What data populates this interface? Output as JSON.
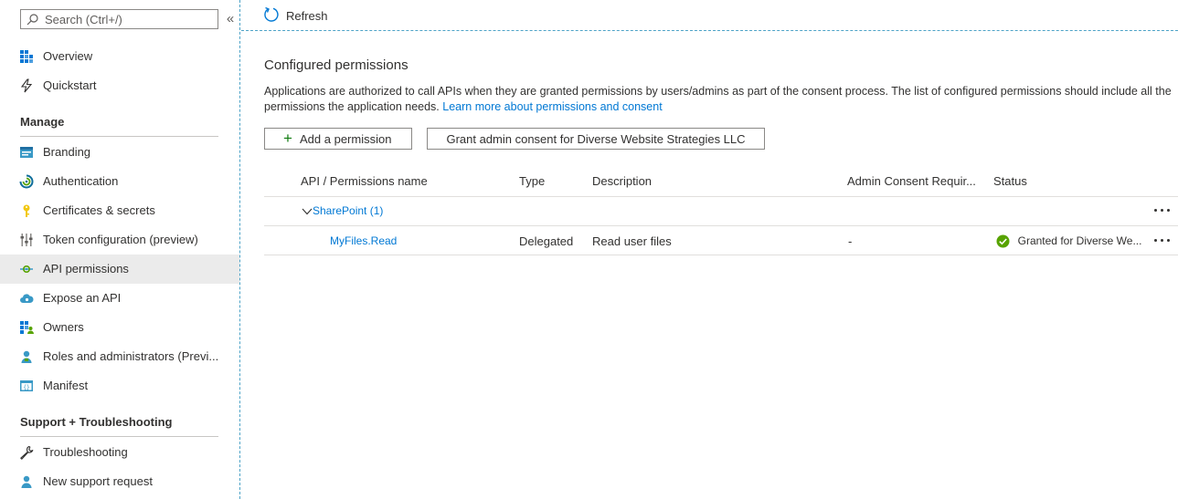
{
  "search": {
    "placeholder": "Search (Ctrl+/)"
  },
  "sidebar": {
    "collapse_glyph": "«",
    "top_items": [
      {
        "label": "Overview",
        "icon": "overview-grid-icon"
      },
      {
        "label": "Quickstart",
        "icon": "lightning-icon"
      }
    ],
    "manage_title": "Manage",
    "manage_items": [
      {
        "label": "Branding",
        "icon": "branding-icon"
      },
      {
        "label": "Authentication",
        "icon": "authentication-icon"
      },
      {
        "label": "Certificates & secrets",
        "icon": "key-icon"
      },
      {
        "label": "Token configuration (preview)",
        "icon": "sliders-icon"
      },
      {
        "label": "API permissions",
        "icon": "api-permissions-icon",
        "active": true
      },
      {
        "label": "Expose an API",
        "icon": "cloud-icon"
      },
      {
        "label": "Owners",
        "icon": "owners-grid-icon"
      },
      {
        "label": "Roles and administrators (Previ...",
        "icon": "person-badge-icon"
      },
      {
        "label": "Manifest",
        "icon": "manifest-icon"
      }
    ],
    "support_title": "Support + Troubleshooting",
    "support_items": [
      {
        "label": "Troubleshooting",
        "icon": "wrench-icon"
      },
      {
        "label": "New support request",
        "icon": "person-support-icon"
      }
    ]
  },
  "toolbar": {
    "refresh_label": "Refresh"
  },
  "main": {
    "title": "Configured permissions",
    "description": "Applications are authorized to call APIs when they are granted permissions by users/admins as part of the consent process. The list of configured permissions should include all the permissions the application needs.",
    "learn_more_link": "Learn more about permissions and consent",
    "add_permission_label": "Add a permission",
    "add_glyph": "+",
    "grant_consent_label": "Grant admin consent for Diverse Website Strategies LLC"
  },
  "table": {
    "headers": {
      "api": "API / Permissions name",
      "type": "Type",
      "description": "Description",
      "admin_consent": "Admin Consent Requir...",
      "status": "Status"
    },
    "group": {
      "label": "SharePoint (1)"
    },
    "rows": [
      {
        "name": "MyFiles.Read",
        "type": "Delegated",
        "description": "Read user files",
        "admin_consent": "-",
        "status": "Granted for Diverse We..."
      }
    ]
  },
  "colors": {
    "accent": "#0078d4",
    "success": "#57a300",
    "border": "#8a8886"
  }
}
